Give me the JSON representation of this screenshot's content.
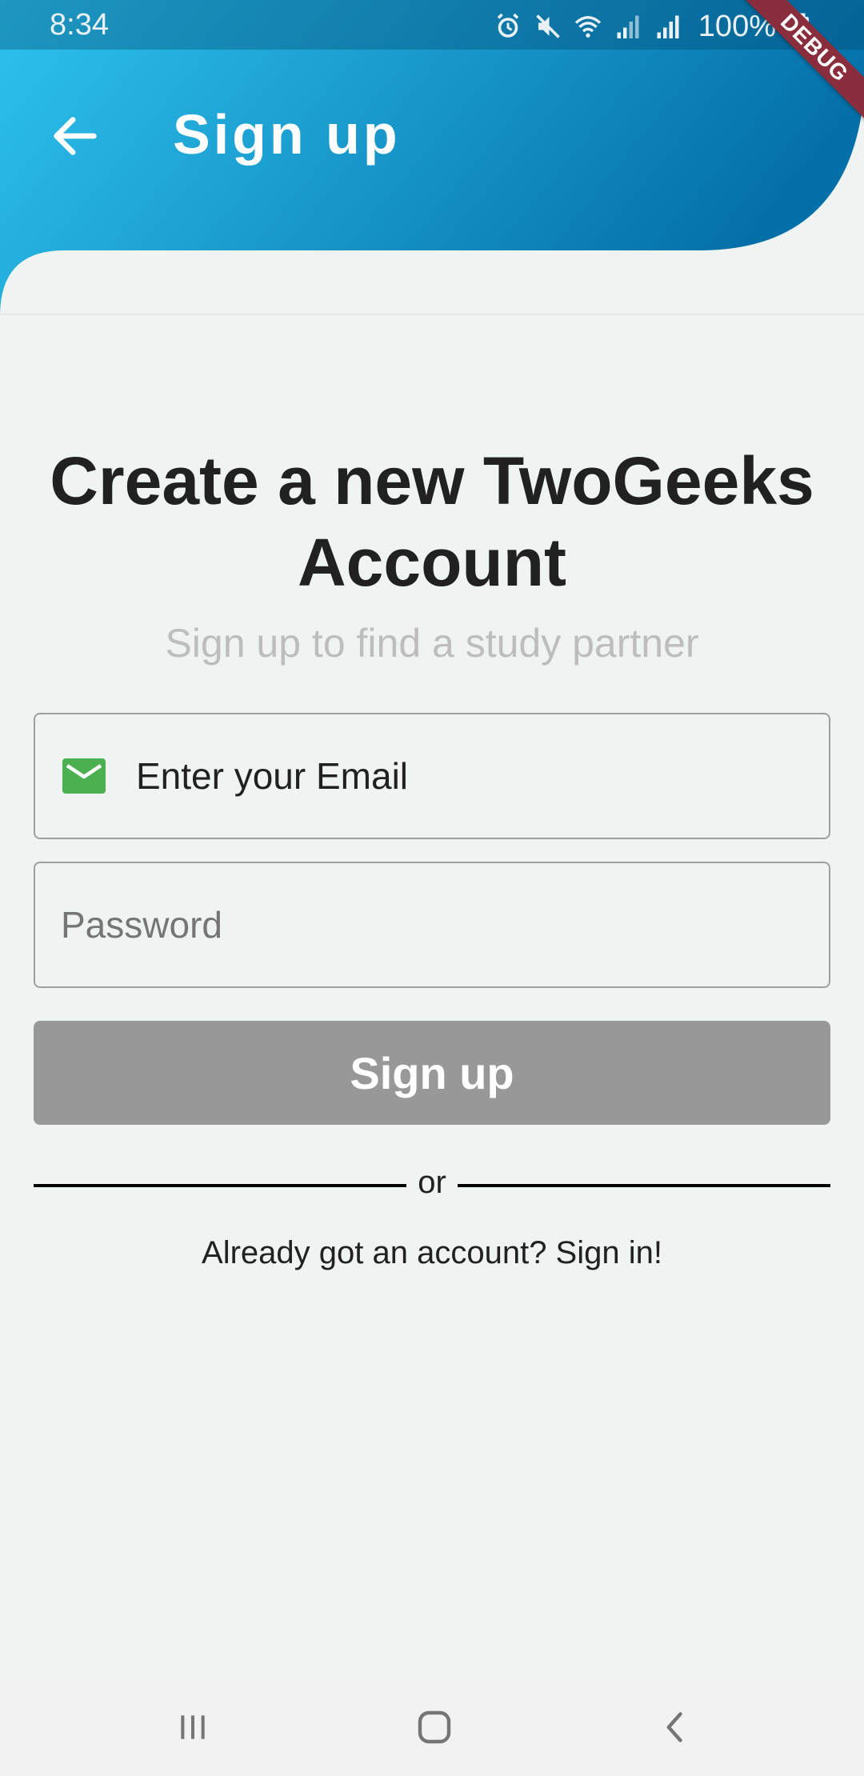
{
  "status_bar": {
    "time": "8:34",
    "battery": "100%",
    "icons": [
      "alarm-icon",
      "mute-icon",
      "wifi-icon",
      "signal-icon",
      "signal-icon",
      "battery-icon"
    ]
  },
  "debug_banner": "DEBUG",
  "app_bar": {
    "title": "Sign up",
    "back_icon": "arrow-back-icon"
  },
  "main": {
    "heading": "Create a new TwoGeeks Account",
    "subtitle": "Sign up to find a study partner",
    "email": {
      "placeholder": "Enter your Email",
      "icon": "email-icon",
      "value": ""
    },
    "password": {
      "placeholder": "Password",
      "value": ""
    },
    "signup_button": "Sign up",
    "divider_text": "or",
    "signin_link": "Already got an account? Sign in!"
  },
  "nav_bar": {
    "items": [
      "recents-icon",
      "home-icon",
      "back-icon"
    ]
  },
  "colors": {
    "header_gradient_start": "#2ec3ee",
    "header_gradient_end": "#0470a9",
    "background": "#eff4f2",
    "button_disabled": "#989898",
    "email_icon": "#4caf50",
    "debug_ribbon": "#8a2d3c"
  }
}
